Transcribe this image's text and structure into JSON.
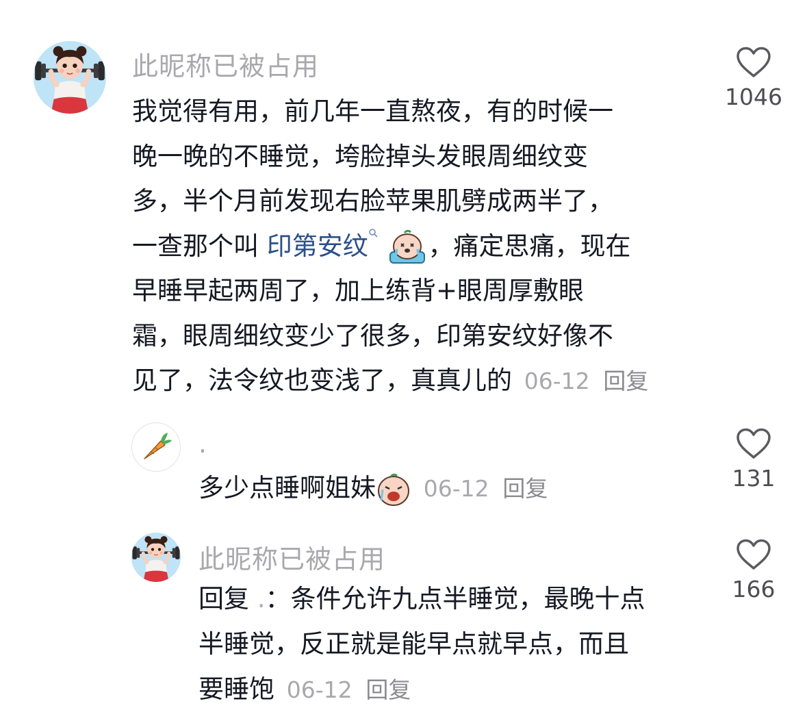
{
  "comments": [
    {
      "username": "此昵称已被占用",
      "lines": [
        "我觉得有用，前几年一直熬夜，有的时候一",
        "晚一晚的不睡觉，垮脸掉头发眼周细纹变",
        "多，半个月前发现右脸苹果肌劈成两半了，"
      ],
      "line4_pre": "一查那个叫 ",
      "line4_link": "印第安纹",
      "line4_post": "，痛定思痛，现在",
      "lines_after": [
        "早睡早起两周了，加上练背+眼周厚敷眼",
        "霜，眼周细纹变少了很多，印第安纹好像不"
      ],
      "last_line": "见了，法令纹也变浅了，真真儿的",
      "date": "06-12",
      "reply_label": "回复",
      "like_count": "1046",
      "emoji": "crying-emoji",
      "avatar_icon": "weightlifter-girl-avatar"
    },
    {
      "username": ".",
      "text": "多少点睡啊姐妹",
      "date": "06-12",
      "reply_label": "回复",
      "like_count": "131",
      "emoji": "sobbing-emoji",
      "avatar_icon": "carrot-avatar"
    },
    {
      "username": "此昵称已被占用",
      "reply_prefix": "回复",
      "reply_target": " .",
      "lines": [
        "：条件允许九点半睡觉，最晚十点",
        "半睡觉，反正就是能早点就早点，而且"
      ],
      "last_line": "要睡饱",
      "date": "06-12",
      "reply_label": "回复",
      "like_count": "166",
      "avatar_icon": "weightlifter-girl-avatar"
    }
  ],
  "icons": {
    "like": "heart-icon",
    "search": "search-icon"
  }
}
